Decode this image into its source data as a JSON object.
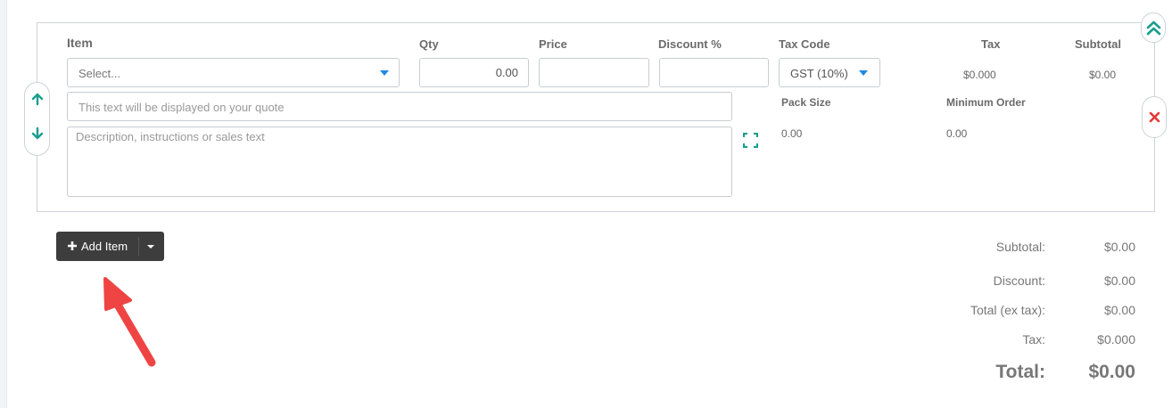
{
  "line_item": {
    "headers": {
      "item": "Item",
      "qty": "Qty",
      "price": "Price",
      "discount": "Discount %",
      "tax_code": "Tax Code",
      "tax": "Tax",
      "subtotal": "Subtotal",
      "pack_size": "Pack Size",
      "minimum_order": "Minimum Order"
    },
    "item_select": {
      "value": "Select..."
    },
    "qty_value": "0.00",
    "price_value": "",
    "discount_value": "",
    "tax_code_value": "GST (10%)",
    "tax_value": "$0.000",
    "subtotal_value": "$0.00",
    "display_text_placeholder": "This text will be displayed on your quote",
    "description_placeholder": "Description, instructions or sales text",
    "pack_size_value": "0.00",
    "minimum_order_value": "0.00"
  },
  "actions": {
    "add_item_label": "Add Item"
  },
  "totals": {
    "subtotal_label": "Subtotal:",
    "subtotal_value": "$0.00",
    "discount_label": "Discount:",
    "discount_value": "$0.00",
    "total_ex_tax_label": "Total (ex tax):",
    "total_ex_tax_value": "$0.00",
    "tax_label": "Tax:",
    "tax_value": "$0.000",
    "total_label": "Total:",
    "total_value": "$0.00"
  },
  "icons": {
    "move_up": "arrow-up-icon",
    "move_down": "arrow-down-icon",
    "collapse": "double-chevron-up-icon",
    "remove": "close-icon",
    "expand": "expand-icon",
    "add": "plus-icon",
    "annotation": "red-arrow-annotation"
  },
  "colors": {
    "accent_teal": "#1a9e8f",
    "dropdown_blue": "#1e88e5",
    "remove_red": "#e53935",
    "button_dark": "#3d3d3d",
    "annotation_red": "#ef4444"
  }
}
